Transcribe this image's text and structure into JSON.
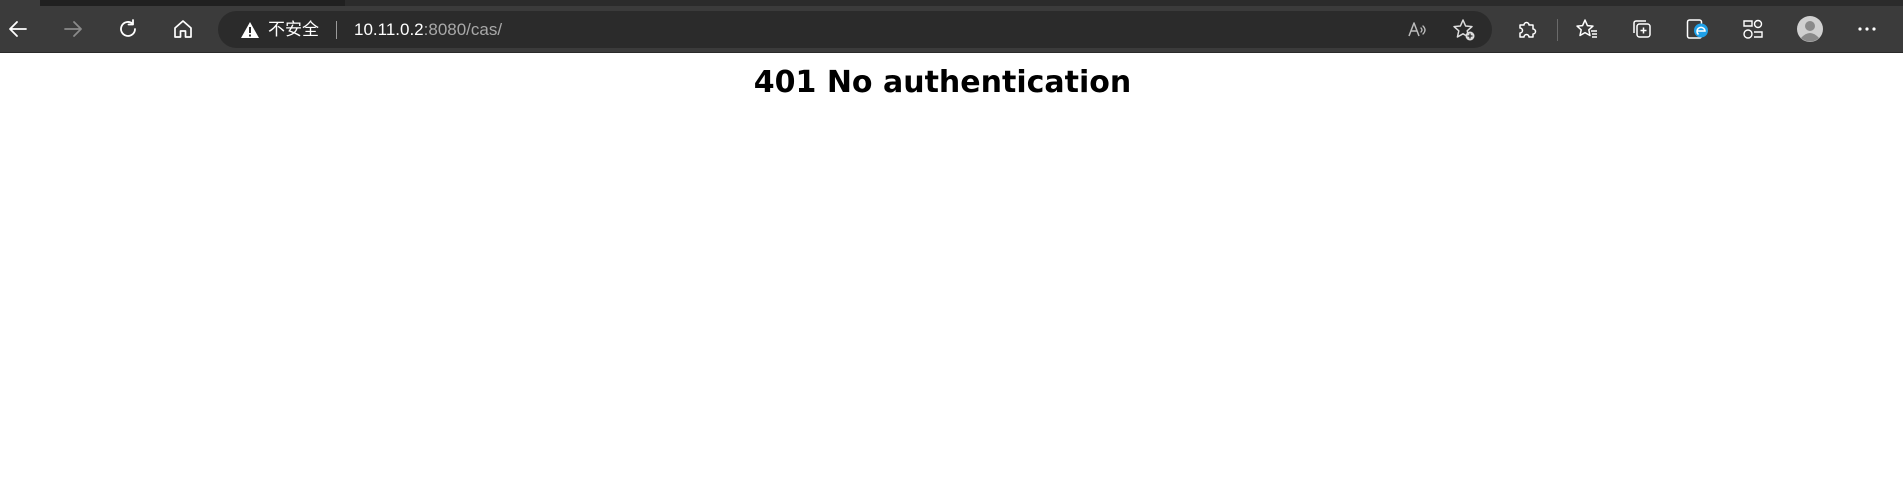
{
  "browser": {
    "address_bar": {
      "security_label": "不安全",
      "url_host": "10.11.0.2",
      "url_rest": ":8080/cas/"
    },
    "icons": {
      "back": "back-arrow-icon",
      "forward": "forward-arrow-icon",
      "refresh": "refresh-icon",
      "home": "home-icon",
      "security_warning": "warning-triangle-icon",
      "read_aloud": "read-aloud-icon",
      "add_favorite": "add-favorite-icon",
      "extensions": "extensions-icon",
      "favorites": "favorites-icon",
      "collections": "collections-icon",
      "edge_bar": "edge-icon",
      "performance": "performance-icon",
      "profile": "profile-avatar-icon",
      "menu": "more-menu-icon"
    },
    "colors": {
      "toolbar": "#3b3b3b",
      "address_bar": "#2b2b2b",
      "edge_accent": "#1fa0e8"
    }
  },
  "page": {
    "heading": "401 No authentication"
  }
}
